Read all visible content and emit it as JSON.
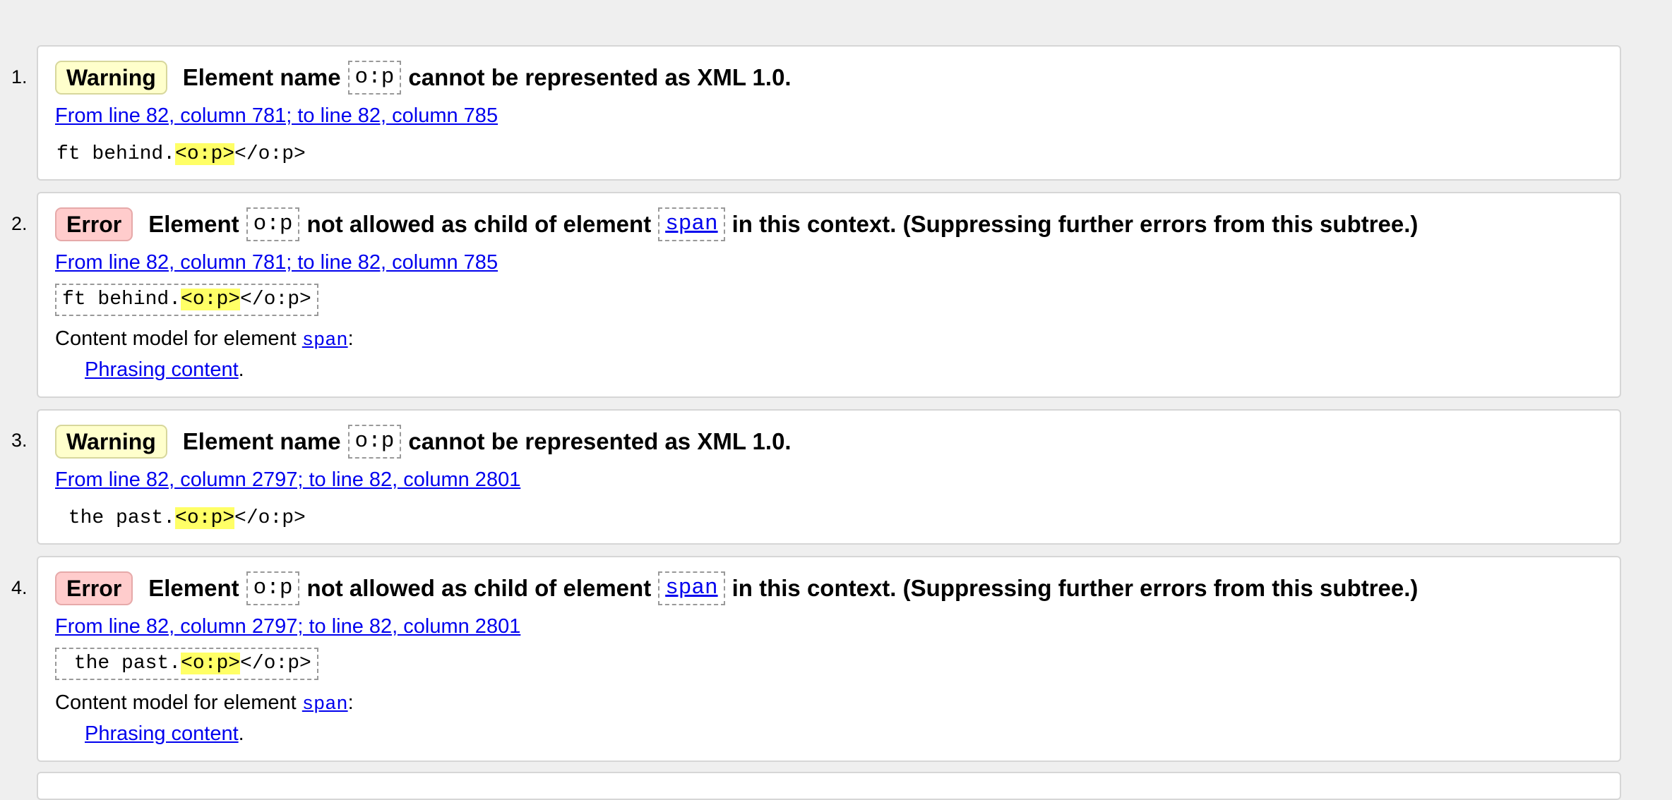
{
  "messages": [
    {
      "number": "1.",
      "type": "Warning",
      "text_before": "Element name",
      "code1": "o:p",
      "text_after": "cannot be represented as XML 1.0.",
      "location": "From line 82, column 781; to line 82, column 785",
      "extract_before": "ft behind.",
      "extract_highlight": "<o:p>",
      "extract_after": "</o:p>"
    },
    {
      "number": "2.",
      "type": "Error",
      "text_before": "Element",
      "code1": "o:p",
      "text_middle": "not allowed as child of element",
      "code2": "span",
      "text_after": "in this context. (Suppressing further errors from this subtree.)",
      "location": "From line 82, column 781; to line 82, column 785",
      "extract_before": "ft behind.",
      "extract_highlight": "<o:p>",
      "extract_after": "</o:p>",
      "content_model_label": "Content model for element",
      "content_model_element": "span",
      "content_model_colon": ":",
      "content_model_link": "Phrasing content",
      "content_model_period": "."
    },
    {
      "number": "3.",
      "type": "Warning",
      "text_before": "Element name",
      "code1": "o:p",
      "text_after": "cannot be represented as XML 1.0.",
      "location": "From line 82, column 2797; to line 82, column 2801",
      "extract_before": " the past.",
      "extract_highlight": "<o:p>",
      "extract_after": "</o:p>"
    },
    {
      "number": "4.",
      "type": "Error",
      "text_before": "Element",
      "code1": "o:p",
      "text_middle": "not allowed as child of element",
      "code2": "span",
      "text_after": "in this context. (Suppressing further errors from this subtree.)",
      "location": "From line 82, column 2797; to line 82, column 2801",
      "extract_before": " the past.",
      "extract_highlight": "<o:p>",
      "extract_after": "</o:p>",
      "content_model_label": "Content model for element",
      "content_model_element": "span",
      "content_model_colon": ":",
      "content_model_link": "Phrasing content",
      "content_model_period": "."
    }
  ],
  "colors": {
    "warning_badge_bg": "#ffffcc",
    "error_badge_bg": "#ffcccc",
    "link": "#0000ee",
    "highlight": "#ffff66",
    "page_bg": "#efefef"
  }
}
